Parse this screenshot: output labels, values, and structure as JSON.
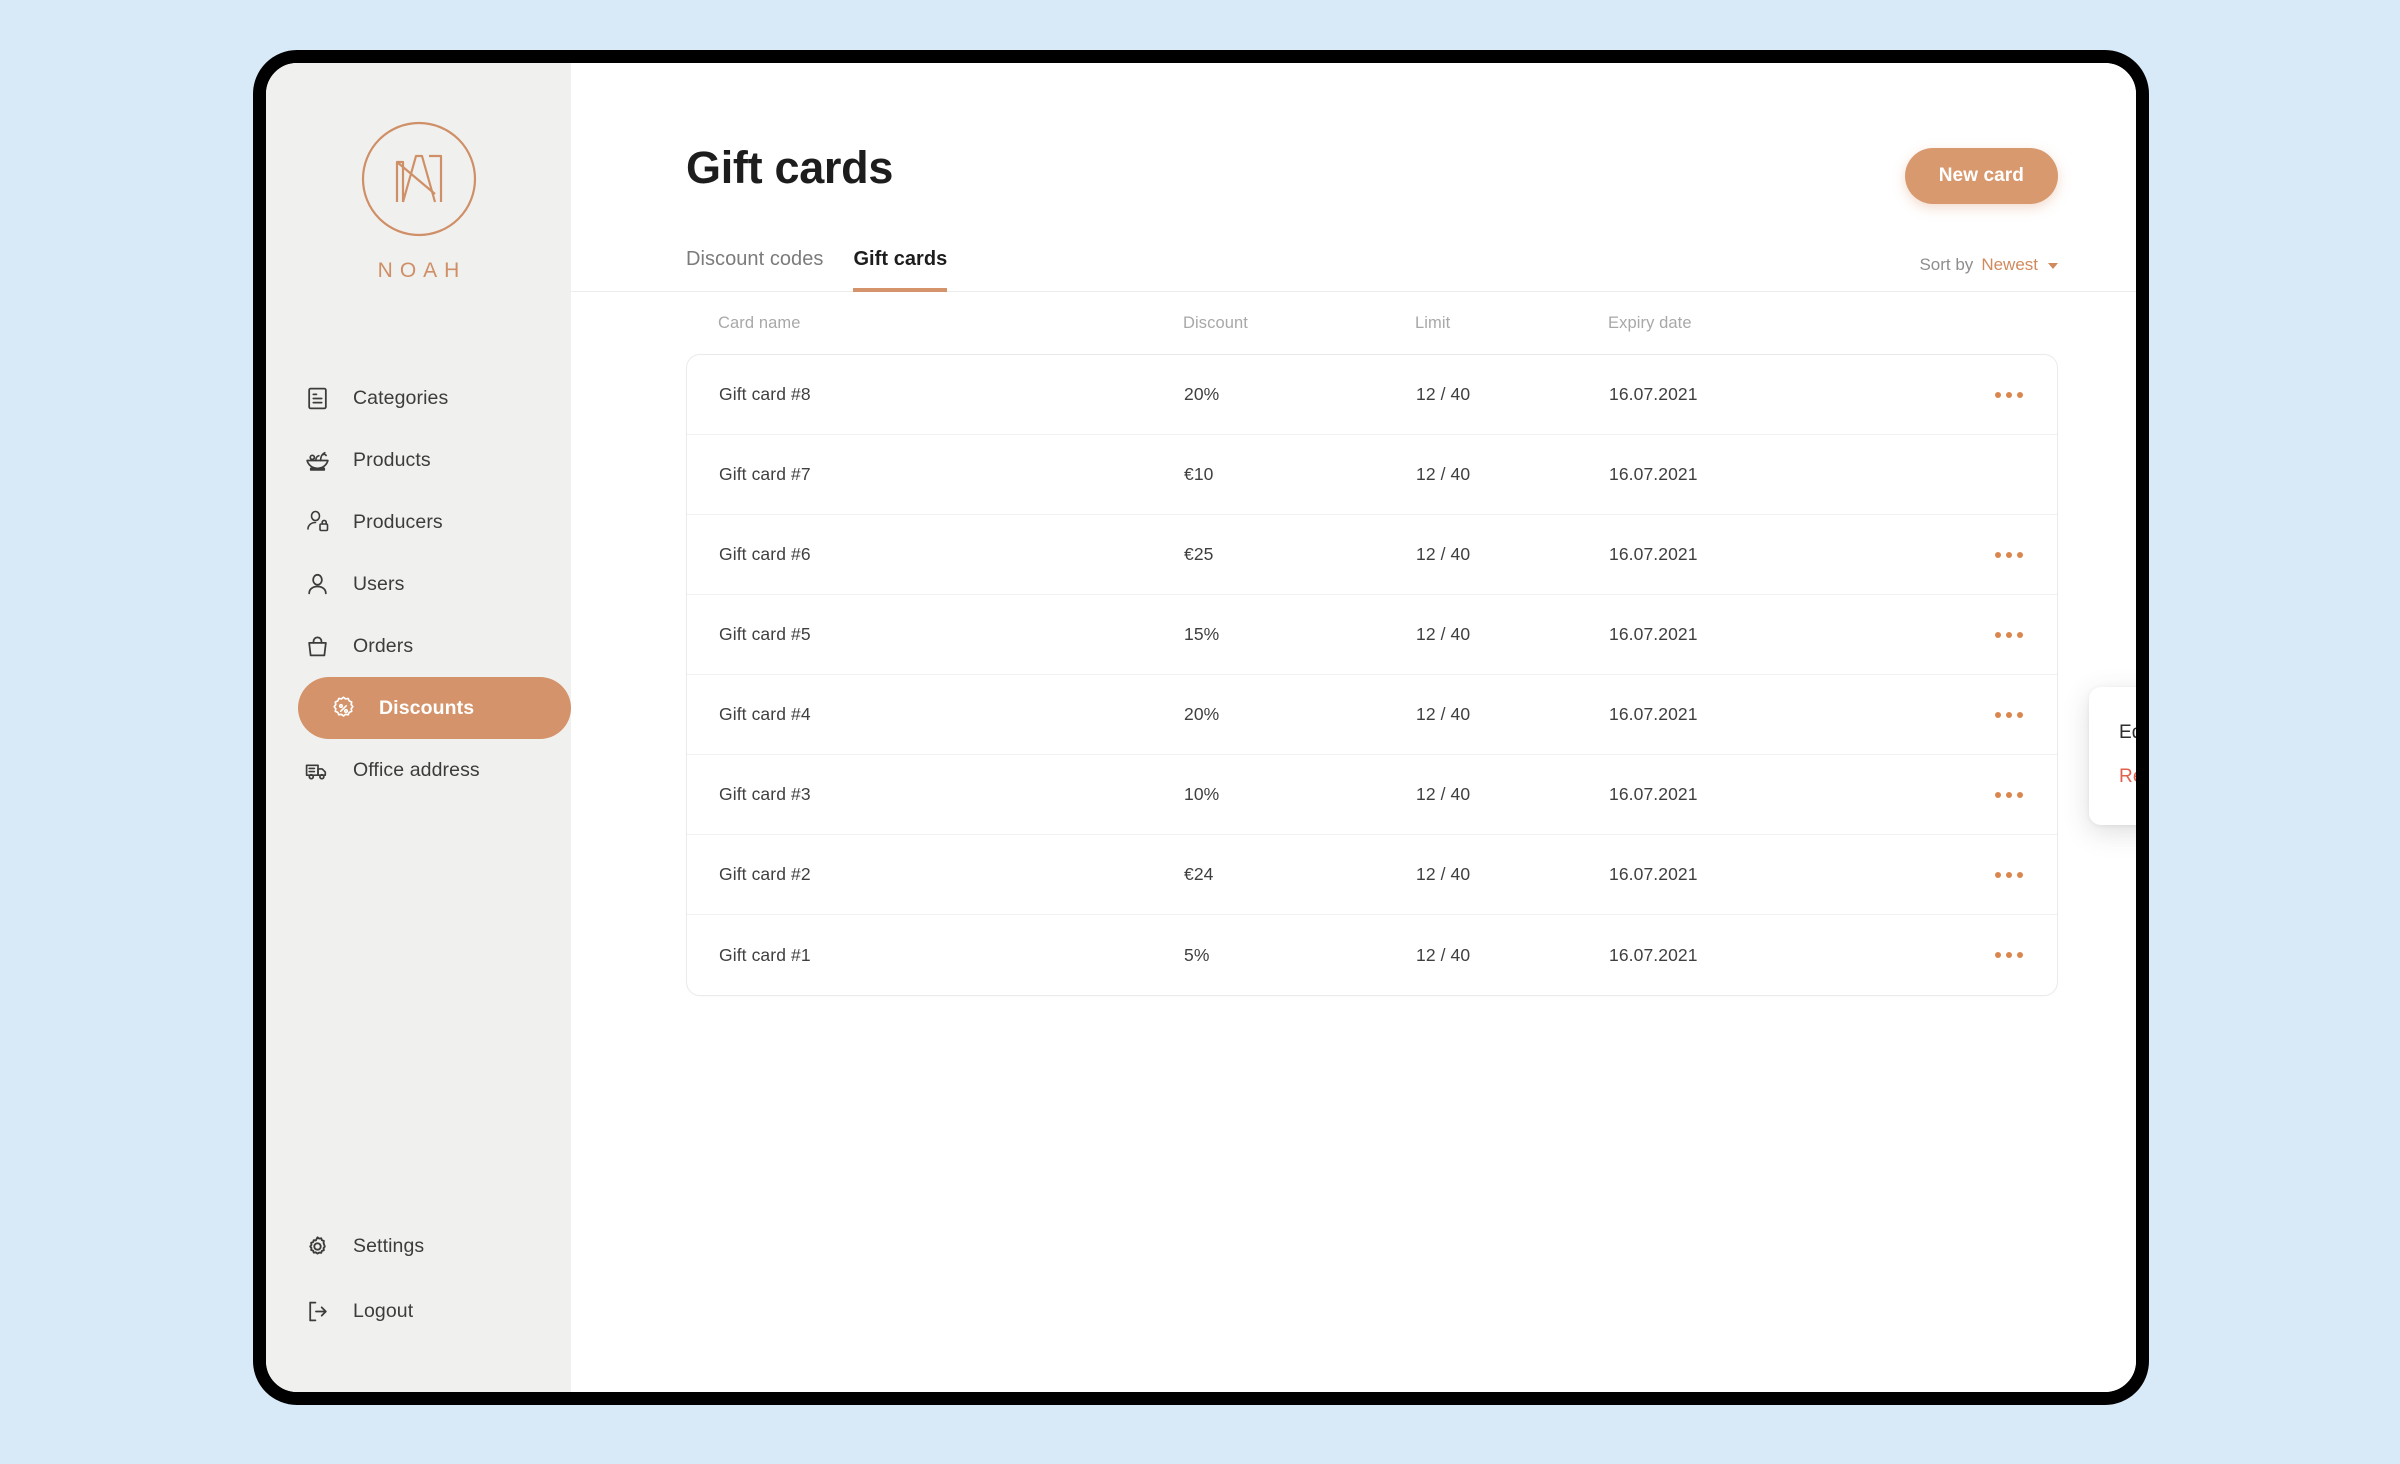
{
  "brand": {
    "name": "NOAH",
    "mark_icon": "noah-monogram-icon"
  },
  "sidebar": {
    "primary_items": [
      {
        "label": "Categories",
        "icon": "document-list-icon",
        "active": false
      },
      {
        "label": "Products",
        "icon": "salad-bowl-icon",
        "active": false
      },
      {
        "label": "Producers",
        "icon": "user-bag-icon",
        "active": false
      },
      {
        "label": "Users",
        "icon": "user-icon",
        "active": false
      },
      {
        "label": "Orders",
        "icon": "shopping-bag-icon",
        "active": false
      },
      {
        "label": "Discounts",
        "icon": "discount-badge-icon",
        "active": true
      },
      {
        "label": "Office address",
        "icon": "delivery-truck-icon",
        "active": false
      }
    ],
    "bottom_items": [
      {
        "label": "Settings",
        "icon": "gear-icon"
      },
      {
        "label": "Logout",
        "icon": "logout-arrow-icon"
      }
    ]
  },
  "header": {
    "title": "Gift cards",
    "new_card_label": "New card"
  },
  "tabs": [
    {
      "label": "Discount codes",
      "active": false
    },
    {
      "label": "Gift cards",
      "active": true
    }
  ],
  "sort": {
    "label": "Sort by",
    "value": "Newest",
    "caret_icon": "chevron-down-icon"
  },
  "table": {
    "columns": [
      "Card name",
      "Discount",
      "Limit",
      "Expiry date"
    ],
    "rows": [
      {
        "name": "Gift card #8",
        "discount": "20%",
        "limit": "12 / 40",
        "expiry": "16.07.2021"
      },
      {
        "name": "Gift card #7",
        "discount": "€10",
        "limit": "12 / 40",
        "expiry": "16.07.2021"
      },
      {
        "name": "Gift card #6",
        "discount": "€25",
        "limit": "12 / 40",
        "expiry": "16.07.2021"
      },
      {
        "name": "Gift card #5",
        "discount": "15%",
        "limit": "12 / 40",
        "expiry": "16.07.2021"
      },
      {
        "name": "Gift card #4",
        "discount": "20%",
        "limit": "12 / 40",
        "expiry": "16.07.2021"
      },
      {
        "name": "Gift card #3",
        "discount": "10%",
        "limit": "12 / 40",
        "expiry": "16.07.2021"
      },
      {
        "name": "Gift card #2",
        "discount": "€24",
        "limit": "12 / 40",
        "expiry": "16.07.2021"
      },
      {
        "name": "Gift card #1",
        "discount": "5%",
        "limit": "12 / 40",
        "expiry": "16.07.2021"
      }
    ],
    "row_menu_icon": "kebab-horizontal-icon"
  },
  "context_menu": {
    "items": [
      {
        "label": "Edit",
        "style": "edit"
      },
      {
        "label": "Remove",
        "style": "remove"
      }
    ]
  },
  "colors": {
    "accent": "#d4936a",
    "accent_button": "#d9996f",
    "brand": "#cf8f67",
    "danger": "#e2614d",
    "page_background": "#d8e9f8",
    "sidebar_background": "#f0f0ee",
    "frame_border": "#000000"
  }
}
